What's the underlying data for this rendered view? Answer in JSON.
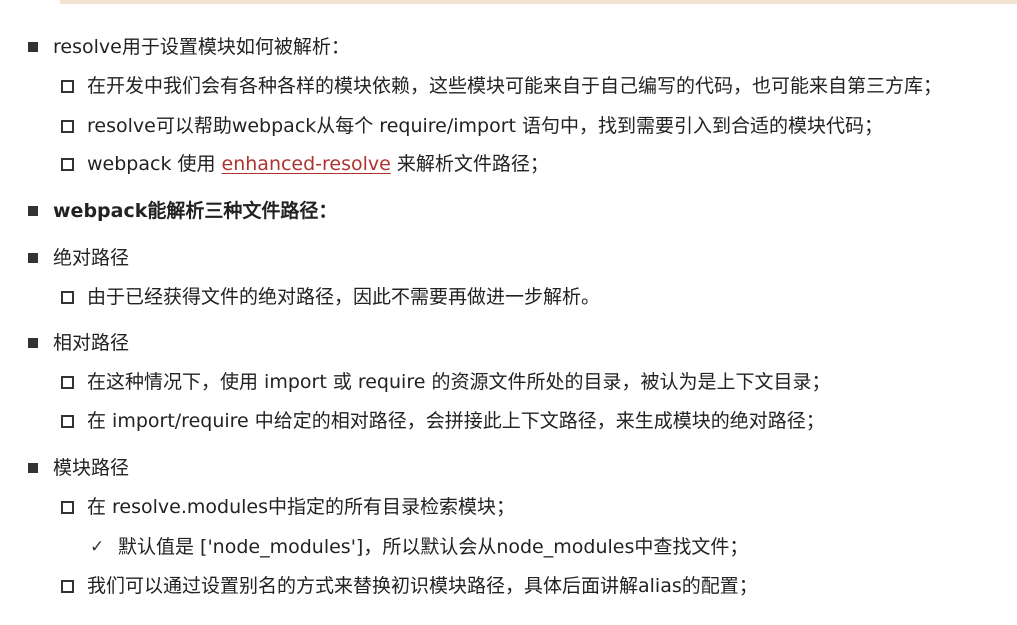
{
  "sections": {
    "resolve": {
      "heading": "resolve用于设置模块如何被解析：",
      "item1": "在开发中我们会有各种各样的模块依赖，这些模块可能来自于自己编写的代码，也可能来自第三方库；",
      "item2": "resolve可以帮助webpack从每个 require/import 语句中，找到需要引入到合适的模块代码；",
      "item3_prefix": "webpack 使用 ",
      "item3_link": "enhanced-resolve",
      "item3_suffix": " 来解析文件路径；"
    },
    "paths_heading": "webpack能解析三种文件路径：",
    "absolute": {
      "heading": "绝对路径",
      "item1": "由于已经获得文件的绝对路径，因此不需要再做进一步解析。"
    },
    "relative": {
      "heading": "相对路径",
      "item1": "在这种情况下，使用 import 或 require 的资源文件所处的目录，被认为是上下文目录；",
      "item2": "在 import/require 中给定的相对路径，会拼接此上下文路径，来生成模块的绝对路径；"
    },
    "module": {
      "heading": "模块路径",
      "item1": "在 resolve.modules中指定的所有目录检索模块；",
      "item1_sub": "默认值是 ['node_modules']，所以默认会从node_modules中查找文件；",
      "item2": "我们可以通过设置别名的方式来替换初识模块路径，具体后面讲解alias的配置；"
    }
  },
  "colors": {
    "link": "#b0322e",
    "text": "#222222",
    "top_rule": "#f3e4d2"
  },
  "icons": {
    "level1": "filled-square-bullet",
    "level2": "hollow-square-bullet",
    "level3": "checkmark"
  }
}
